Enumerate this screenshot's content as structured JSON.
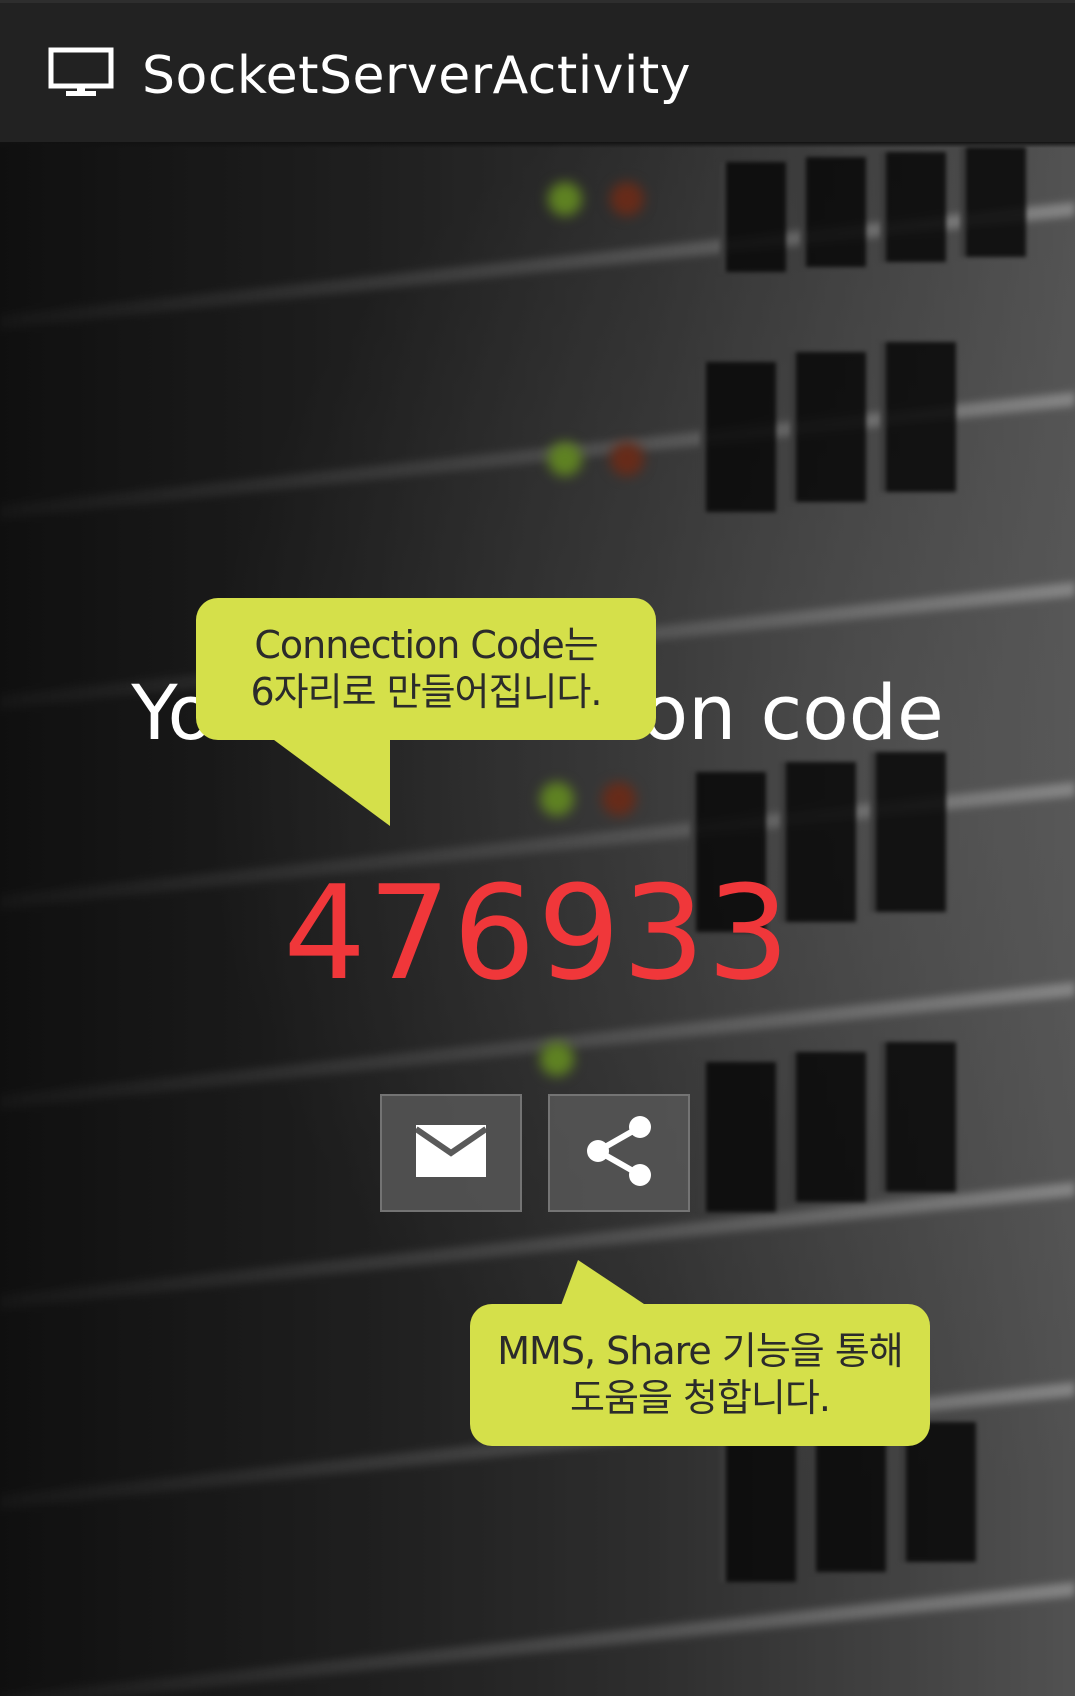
{
  "action_bar": {
    "title": "SocketServerActivity",
    "icon": "monitor-icon"
  },
  "main": {
    "heading": "Your connection code",
    "connection_code": "476933",
    "code_color": "#f0373a"
  },
  "buttons": {
    "mms": {
      "icon": "mail-icon"
    },
    "share": {
      "icon": "share-icon"
    }
  },
  "tooltips": {
    "code_tip": {
      "line1": "Connection Code는",
      "line2": "6자리로 만들어집니다."
    },
    "share_tip": {
      "line1": "MMS, Share 기능을 통해",
      "line2": "도움을 청합니다."
    },
    "color": "#d5e04a"
  }
}
